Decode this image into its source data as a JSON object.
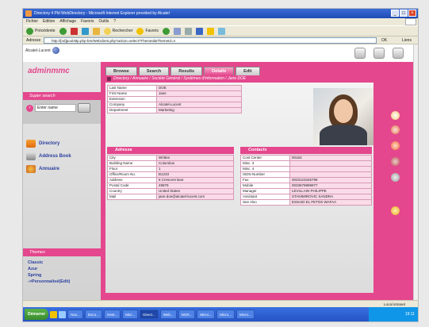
{
  "window": {
    "title": "Directory 4 Pld WebDirectory - Microsoft Internet Explorer provided by Alcatel"
  },
  "menubar": [
    "Fichier",
    "Edition",
    "Affichage",
    "Favoris",
    "Outils",
    "?"
  ],
  "toolbar": {
    "back_label": "Précédente",
    "search_label": "Rechercher",
    "favorites_label": "Favoris"
  },
  "addressbar": {
    "label": "Adresse",
    "url": "http://[nd]pool4ttp.php-bm/Webclient.php?action=select?ThemeId&ThemeId=4",
    "go_label": "OK",
    "links_label": "Liens"
  },
  "brand": {
    "logo_text": "Alcatel-Lucent",
    "app_name": "adminmmc"
  },
  "sidebar": {
    "quick_search_title": "Super search",
    "enter_name_placeholder": "Enter name",
    "nav": [
      {
        "label": "Directory",
        "icon": "directory-icon"
      },
      {
        "label": "Address Book",
        "icon": "address-book-icon"
      },
      {
        "label": "Annuaire",
        "icon": "annuaire-icon"
      }
    ],
    "themes_title": "Themes",
    "themes": [
      "Classic",
      "Azur",
      "Spring",
      "->Personnalisé(Edit)"
    ]
  },
  "tabs": [
    "Browse",
    "Search",
    "Results",
    "Details",
    "Edit"
  ],
  "active_tab": "Details",
  "breadcrumb": "Directory / Annuaire / Société Général / Systèmes d'information / Jane DOE",
  "person": [
    {
      "key": "Last Name",
      "value": "DOE"
    },
    {
      "key": "First Name",
      "value": "Jane"
    },
    {
      "key": "Extension",
      "value": ""
    },
    {
      "key": "Company",
      "value": "Alcatel-Lucent"
    },
    {
      "key": "Department",
      "value": "Marketing"
    }
  ],
  "address_title": "Adresse",
  "address": [
    {
      "key": "City",
      "value": "Written"
    },
    {
      "key": "Building Name",
      "value": "Columbus"
    },
    {
      "key": "Floor",
      "value": "1"
    },
    {
      "key": "Office/Room No.",
      "value": "B1233"
    },
    {
      "key": "Address",
      "value": "6 Crescent lane"
    },
    {
      "key": "Postal Code",
      "value": "49879"
    },
    {
      "key": "Country",
      "value": "United States"
    },
    {
      "key": "Mail",
      "value": "jane.doe@alcatel-lucent.com"
    }
  ],
  "contacts_title": "Contacts",
  "contacts": [
    {
      "key": "Cost Center",
      "value": "00163"
    },
    {
      "key": "Misc. 3",
      "value": ""
    },
    {
      "key": "Misc. 4",
      "value": ""
    },
    {
      "key": "ISDN Number",
      "value": ""
    },
    {
      "key": "Fax",
      "value": "0033123345798"
    },
    {
      "key": "Mobile",
      "value": "0033679999977"
    },
    {
      "key": "Manager",
      "value": "LEVILLAIN PHILIPPE"
    },
    {
      "key": "Assistant",
      "value": "STANIMIROVIC SANDRA"
    },
    {
      "key": "See Also",
      "value": "ESSAID EL FETOS WAFAA"
    }
  ],
  "statusbar": {
    "zone": "Local intranet"
  },
  "taskbar": {
    "start_label": "Démarrer",
    "items": [
      "Nov...",
      "Doco...",
      "Gest...",
      "Micr...",
      "Direct...",
      "Web...",
      "NGR...",
      "Micro...",
      "Micro...",
      "Micro..."
    ],
    "active_index": 4,
    "clock": "19:11"
  }
}
